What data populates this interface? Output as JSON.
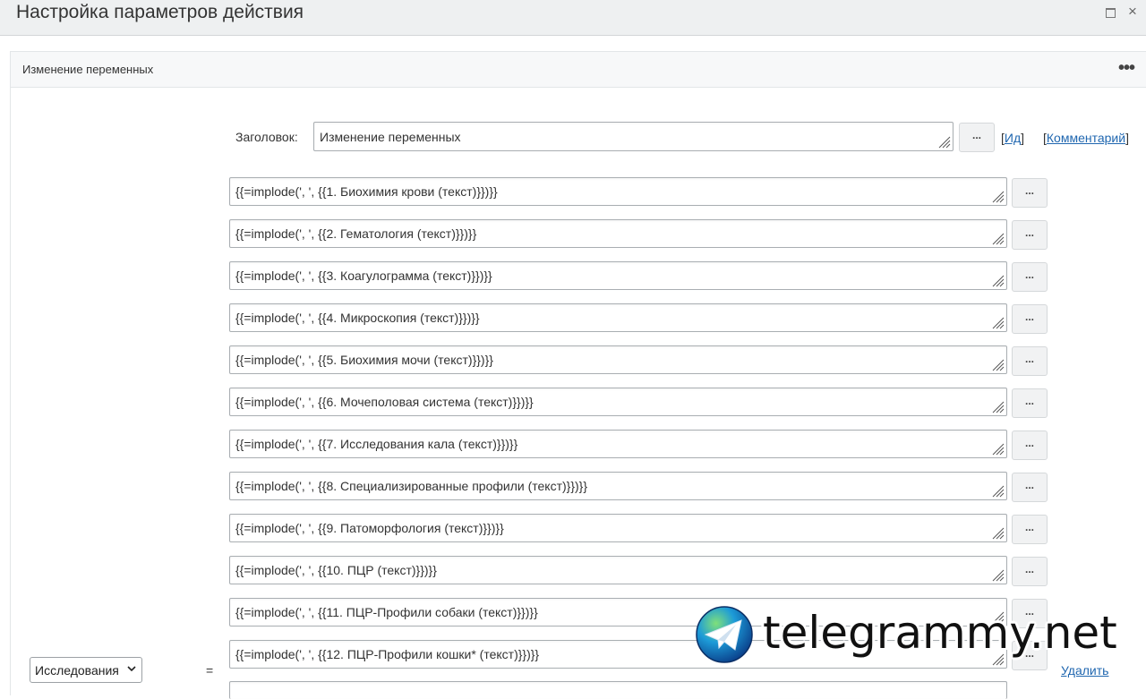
{
  "window": {
    "title": "Настройка параметров действия",
    "maximize_icon": "maximize-icon",
    "close_glyph": "×"
  },
  "panel": {
    "title": "Изменение переменных",
    "menu_glyph": "•••"
  },
  "header_field": {
    "label": "Заголовок:",
    "value": "Изменение переменных",
    "picker_label": "...",
    "id_link": "Ид",
    "comment_link": "Комментарий",
    "bracket_open": "[",
    "bracket_close": "]"
  },
  "expressions": [
    {
      "value": "{{=implode(', ', {{1. Биохимия крови (текст)}})}}",
      "button": "..."
    },
    {
      "value": "{{=implode(', ', {{2. Гематология (текст)}})}}",
      "button": "..."
    },
    {
      "value": "{{=implode(', ', {{3. Коагулограмма (текст)}})}}",
      "button": "..."
    },
    {
      "value": "{{=implode(', ', {{4. Микроскопия (текст)}})}}",
      "button": "..."
    },
    {
      "value": "{{=implode(', ', {{5. Биохимия мочи (текст)}})}}",
      "button": "..."
    },
    {
      "value": "{{=implode(', ', {{6. Мочеполовая система (текст)}})}}",
      "button": "..."
    },
    {
      "value": "{{=implode(', ', {{7. Исследования кала (текст)}})}}",
      "button": "..."
    },
    {
      "value": "{{=implode(', ', {{8. Специализированные профили (текст)}})}}",
      "button": "..."
    },
    {
      "value": "{{=implode(', ', {{9. Патоморфология (текст)}})}}",
      "button": "..."
    },
    {
      "value": "{{=implode(', ', {{10. ПЦР (текст)}})}}",
      "button": "..."
    },
    {
      "value": "{{=implode(', ', {{11. ПЦР-Профили собаки (текст)}})}}",
      "button": "..."
    },
    {
      "value": "{{=implode(', ', {{12. ПЦР-Профили кошки* (текст)}})}}",
      "button": "..."
    }
  ],
  "variable_select": {
    "value": "Исследования"
  },
  "equals_sign": "=",
  "delete_link": "Удалить",
  "watermark": {
    "text": "telegrammy.net"
  },
  "colors": {
    "link": "#2067b0",
    "titlebar_bg": "#eef0f1",
    "panel_head_bg": "#f7f8f9",
    "field_border": "#a9aeb2",
    "button_bg": "#f1f2f3"
  }
}
